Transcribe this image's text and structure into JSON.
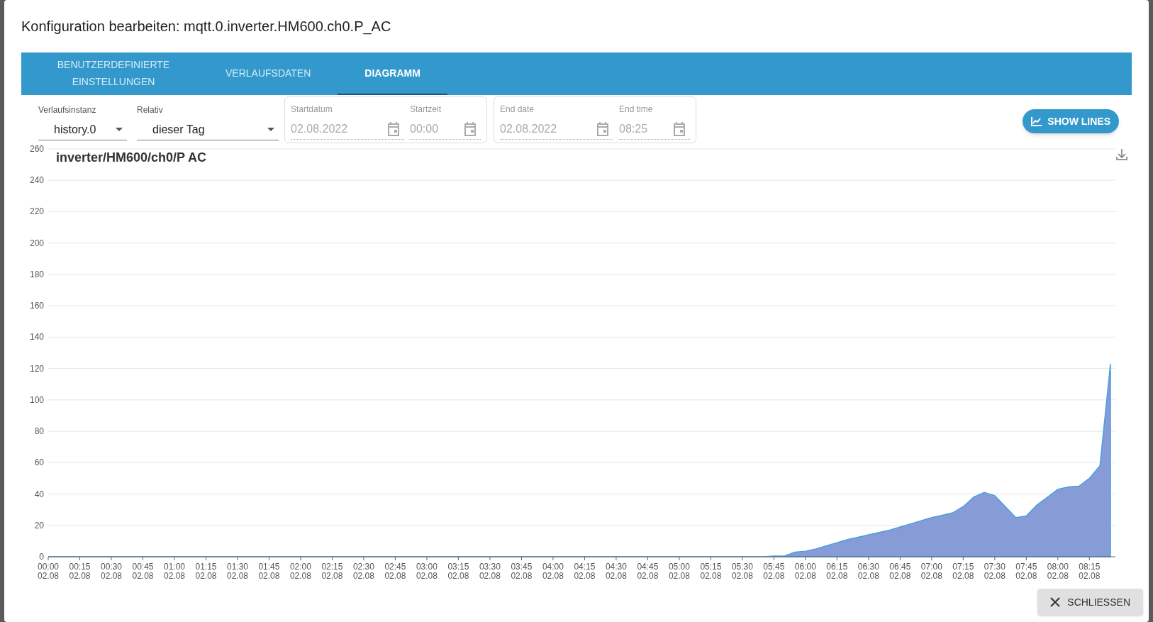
{
  "dialog": {
    "title": "Konfiguration bearbeiten: mqtt.0.inverter.HM600.ch0.P_AC"
  },
  "tabs": [
    {
      "label": "BENUTZERDEFINIERTE EINSTELLUNGEN",
      "selected": false
    },
    {
      "label": "VERLAUFSDATEN",
      "selected": false
    },
    {
      "label": "DIAGRAMM",
      "selected": true
    }
  ],
  "selects": [
    {
      "label": "Verlaufsinstanz",
      "value": "history.0"
    },
    {
      "label": "Relativ",
      "value": "dieser Tag"
    }
  ],
  "ranges": [
    {
      "fields": [
        {
          "label": "Startdatum",
          "value": "02.08.2022",
          "disabled": true
        },
        {
          "label": "Startzeit",
          "value": "00:00",
          "disabled": true
        }
      ]
    },
    {
      "fields": [
        {
          "label": "End date",
          "value": "02.08.2022",
          "disabled": true
        },
        {
          "label": "End time",
          "value": "08:25",
          "disabled": true
        }
      ]
    }
  ],
  "show_lines_button": {
    "label": "SHOW LINES"
  },
  "chart": {
    "chart_data": {
      "type": "area",
      "title": "inverter/HM600/ch0/P AC",
      "categories": [
        "00:00 02.08",
        null,
        null,
        "00:15 02.08",
        null,
        null,
        "00:30 02.08",
        null,
        null,
        "00:45 02.08",
        null,
        null,
        "01:00 02.08",
        null,
        null,
        "01:15 02.08",
        null,
        null,
        "01:30 02.08",
        null,
        null,
        "01:45 02.08",
        null,
        null,
        "02:00 02.08",
        null,
        null,
        "02:15 02.08",
        null,
        null,
        "02:30 02.08",
        null,
        null,
        "02:45 02.08",
        null,
        null,
        "03:00 02.08",
        null,
        null,
        "03:15 02.08",
        null,
        null,
        "03:30 02.08",
        null,
        null,
        "03:45 02.08",
        null,
        null,
        "04:00 02.08",
        null,
        null,
        "04:15 02.08",
        null,
        null,
        "04:30 02.08",
        null,
        null,
        "04:45 02.08",
        null,
        null,
        "05:00 02.08",
        null,
        null,
        "05:15 02.08",
        null,
        null,
        "05:30 02.08",
        null,
        null,
        "05:45 02.08",
        null,
        null,
        "06:00 02.08",
        null,
        null,
        "06:15 02.08",
        null,
        null,
        "06:30 02.08",
        null,
        null,
        "06:45 02.08",
        null,
        null,
        "07:00 02.08",
        null,
        null,
        "07:15 02.08",
        null,
        null,
        "07:30 02.08",
        null,
        null,
        "07:45 02.08",
        null,
        null,
        "08:00 02.08",
        null,
        null,
        "08:15 02.08",
        null,
        null
      ],
      "series": [
        {
          "color": "#879bd6",
          "values": [
            0,
            0,
            0,
            0,
            0,
            0,
            0,
            0,
            0,
            0,
            0,
            0,
            0,
            0,
            0,
            0,
            0,
            0,
            0,
            0,
            0,
            0,
            0,
            0,
            0,
            0,
            0,
            0,
            0,
            0,
            0,
            0,
            0,
            0,
            0,
            0,
            0,
            0,
            0,
            0,
            0,
            0,
            0,
            0,
            0,
            0,
            0,
            0,
            0,
            0,
            0,
            0,
            0,
            0,
            0,
            0,
            0,
            0,
            0,
            0,
            0,
            0,
            0,
            0,
            0,
            0,
            0,
            0,
            0,
            0.5,
            0.5,
            3,
            3.5,
            5,
            7,
            9,
            11,
            12.5,
            14,
            15.5,
            17,
            19,
            21,
            23,
            25,
            26.5,
            28,
            32,
            38,
            41,
            39,
            32,
            25,
            26,
            33,
            38,
            43,
            44.5,
            45,
            50,
            58,
            123
          ]
        }
      ],
      "ylim": [
        0,
        260
      ],
      "grid": true,
      "yticks": [
        0,
        20,
        40,
        60,
        80,
        100,
        120,
        140,
        160,
        180,
        200,
        220,
        240,
        260
      ]
    }
  },
  "close_button": {
    "label": "SCHLIESSEN"
  }
}
